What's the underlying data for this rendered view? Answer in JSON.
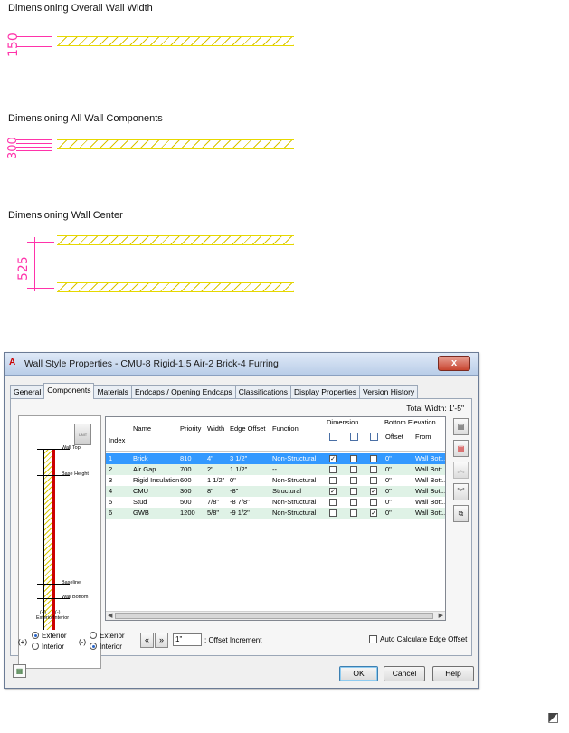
{
  "drawing": {
    "title1": "Dimensioning Overall Wall Width",
    "dim1": "150",
    "title2": "Dimensioning All Wall Components",
    "dim2": "300",
    "title3": "Dimensioning Wall Center",
    "dim3": "525",
    "colors": {
      "wall": "#e6d800",
      "dimension": "#ff33aa"
    }
  },
  "dialog": {
    "app_icon": "A",
    "title": "Wall Style Properties - CMU-8 Rigid-1.5 Air-2 Brick-4 Furring",
    "close": "x",
    "tabs": [
      "General",
      "Components",
      "Materials",
      "Endcaps / Opening Endcaps",
      "Classifications",
      "Display Properties",
      "Version History"
    ],
    "active_tab": "Components",
    "total_width": "Total Width: 1'-5\"",
    "preview": {
      "btn": "UNIT",
      "labels": {
        "wall_top": "Wall Top",
        "base_height": "Base Height",
        "baseline": "Baseline",
        "wall_bottom": "Wall Bottom",
        "exterior_short": "(+)",
        "interior_short": "(-)",
        "exterior_word": "Exterior",
        "interior_word": "Interior"
      }
    },
    "grid": {
      "headers": {
        "index": "Index",
        "name": "Name",
        "priority": "Priority",
        "width": "Width",
        "edge_offset": "Edge Offset",
        "function": "Function",
        "dimension": "Dimension",
        "bottom_elevation": "Bottom Elevation",
        "offset": "Offset",
        "from": "From"
      },
      "rows": [
        {
          "index": "1",
          "name": "Brick",
          "priority": "810",
          "width": "4\"",
          "edge_offset": "3 1/2\"",
          "function": "Non-Structural",
          "c1": "✓",
          "c2": "",
          "c3": "",
          "offset": "0\"",
          "from": "Wall Bott..."
        },
        {
          "index": "2",
          "name": "Air Gap",
          "priority": "700",
          "width": "2\"",
          "edge_offset": "1 1/2\"",
          "function": "--",
          "c1": "",
          "c2": "",
          "c3": "",
          "offset": "0\"",
          "from": "Wall Bott..."
        },
        {
          "index": "3",
          "name": "Rigid Insulation",
          "priority": "600",
          "width": "1 1/2\"",
          "edge_offset": "0\"",
          "function": "Non-Structural",
          "c1": "",
          "c2": "",
          "c3": "",
          "offset": "0\"",
          "from": "Wall Bott..."
        },
        {
          "index": "4",
          "name": "CMU",
          "priority": "300",
          "width": "8\"",
          "edge_offset": "-8\"",
          "function": "Structural",
          "c1": "✓",
          "c2": "",
          "c3": "✓",
          "offset": "0\"",
          "from": "Wall Bott..."
        },
        {
          "index": "5",
          "name": "Stud",
          "priority": "500",
          "width": "7/8\"",
          "edge_offset": "-8 7/8\"",
          "function": "Non-Structural",
          "c1": "",
          "c2": "",
          "c3": "",
          "offset": "0\"",
          "from": "Wall Bott..."
        },
        {
          "index": "6",
          "name": "GWB",
          "priority": "1200",
          "width": "5/8\"",
          "edge_offset": "-9 1/2\"",
          "function": "Non-Structural",
          "c1": "",
          "c2": "",
          "c3": "✓",
          "offset": "0\"",
          "from": "Wall Bott..."
        }
      ]
    },
    "side_buttons": [
      "add-component-icon",
      "delete-component-icon",
      "move-up-icon",
      "move-down-icon",
      "copy-icon"
    ],
    "bottom": {
      "plus": "(+)",
      "minus": "(-)",
      "exterior": "Exterior",
      "interior": "Interior",
      "offset_value": "1\"",
      "offset_label": ": Offset Increment",
      "auto_calc": "Auto Calculate Edge Offset"
    },
    "buttons": {
      "ok": "OK",
      "cancel": "Cancel",
      "help": "Help"
    }
  }
}
